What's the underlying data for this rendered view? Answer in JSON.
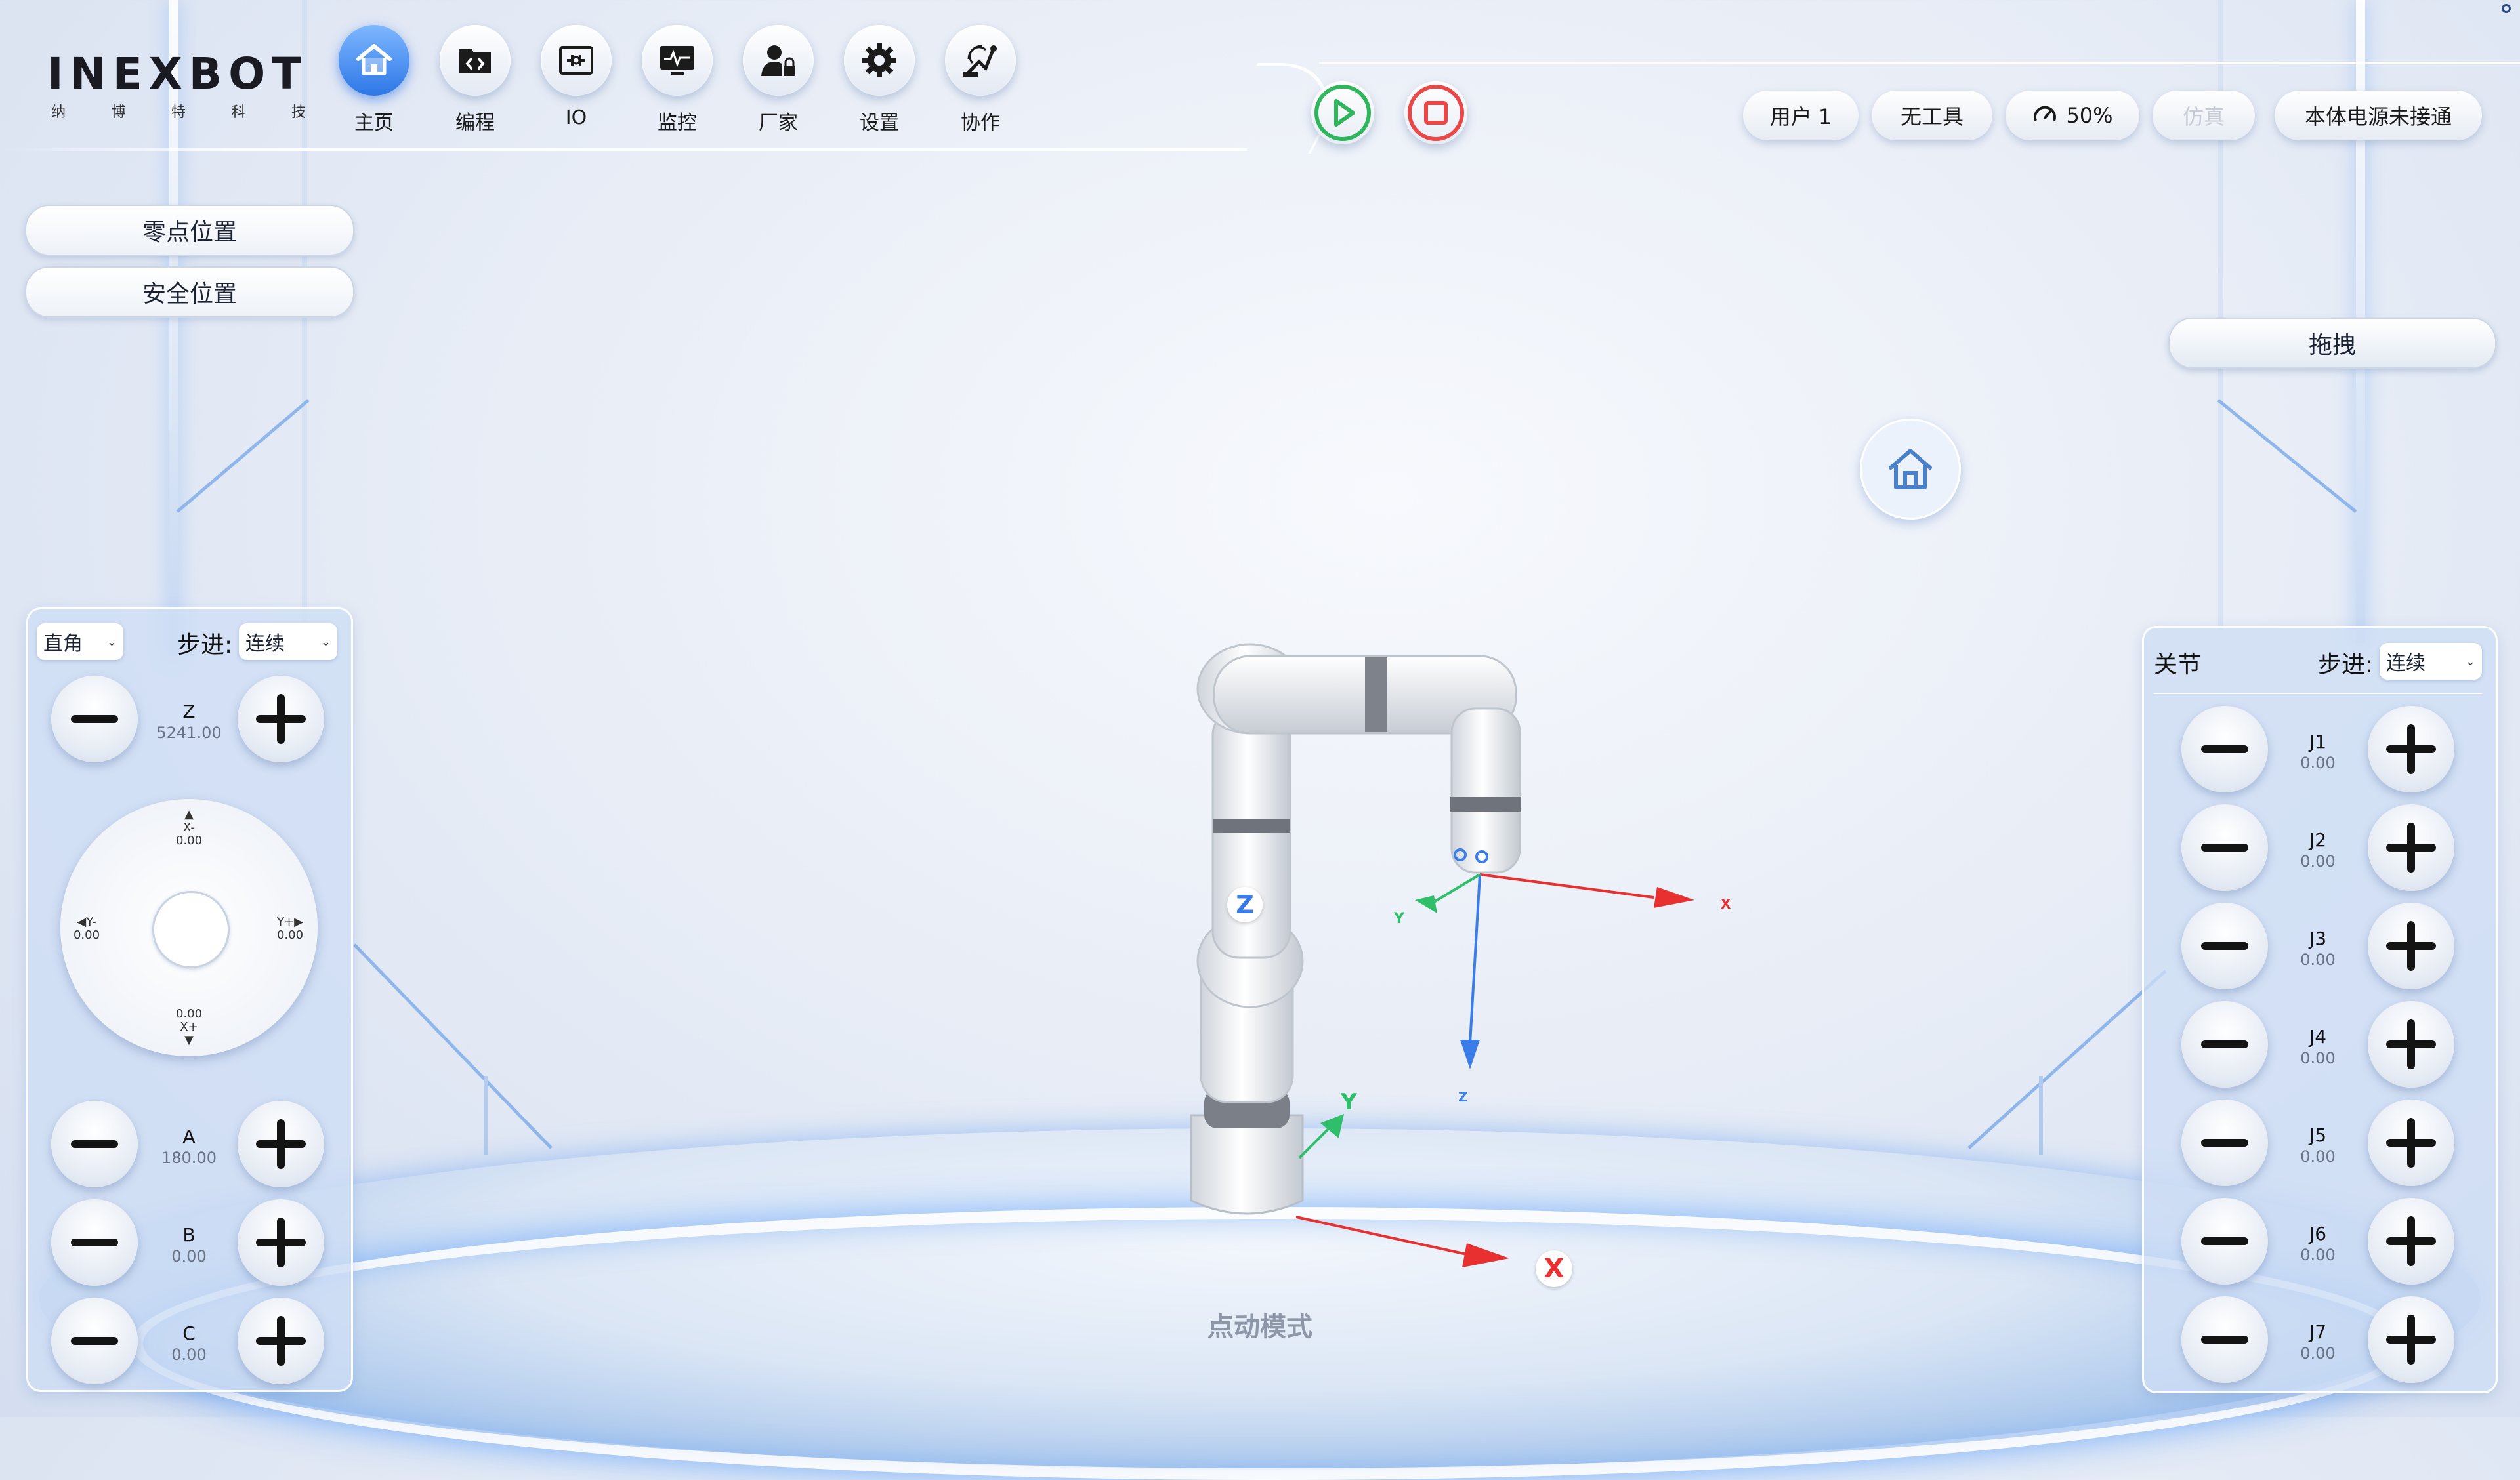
{
  "brand": {
    "name": "INEXBOT",
    "subtitle": [
      "纳",
      "博",
      "特",
      "科",
      "技"
    ]
  },
  "nav": [
    {
      "label": "主页",
      "icon": "home-icon",
      "active": true
    },
    {
      "label": "编程",
      "icon": "code-folder-icon"
    },
    {
      "label": "IO",
      "icon": "io-icon"
    },
    {
      "label": "监控",
      "icon": "monitor-icon"
    },
    {
      "label": "厂家",
      "icon": "manufacturer-lock-icon"
    },
    {
      "label": "设置",
      "icon": "settings-gear-icon"
    },
    {
      "label": "协作",
      "icon": "collaborate-icon"
    }
  ],
  "controls": {
    "run_icon": "play-icon",
    "stop_icon": "stop-icon"
  },
  "status": {
    "user": "用户 1",
    "tool": "无工具",
    "speed": "50%",
    "sim": "仿真",
    "power": "本体电源未接通"
  },
  "left_buttons": {
    "zero": "零点位置",
    "safe": "安全位置"
  },
  "drag_button": "拖拽",
  "cartesian": {
    "coord_select": "直角",
    "step_label": "步进:",
    "step_select": "连续",
    "z": {
      "name": "Z",
      "value": "5241.00"
    },
    "joystick": {
      "x_minus": {
        "name": "X-",
        "value": "0.00"
      },
      "x_plus": {
        "name": "X+",
        "value": "0.00"
      },
      "y_minus": {
        "name": "Y-",
        "value": "0.00"
      },
      "y_plus": {
        "name": "Y+",
        "value": "0.00"
      }
    },
    "a": {
      "name": "A",
      "value": "180.00"
    },
    "b": {
      "name": "B",
      "value": "0.00"
    },
    "c": {
      "name": "C",
      "value": "0.00"
    }
  },
  "joint": {
    "title": "关节",
    "step_label": "步进:",
    "step_select": "连续",
    "joints": [
      {
        "name": "J1",
        "value": "0.00"
      },
      {
        "name": "J2",
        "value": "0.00"
      },
      {
        "name": "J3",
        "value": "0.00"
      },
      {
        "name": "J4",
        "value": "0.00"
      },
      {
        "name": "J5",
        "value": "0.00"
      },
      {
        "name": "J6",
        "value": "0.00"
      },
      {
        "name": "J7",
        "value": "0.00"
      }
    ]
  },
  "scene": {
    "mode": "点动模式",
    "axis_x": "X",
    "axis_y": "Y",
    "axis_z": "Z",
    "tool_x": "X",
    "tool_y": "Y",
    "tool_z": "Z",
    "colors": {
      "x": "#e83030",
      "y": "#2fbf6a",
      "z": "#3a7de8",
      "accent": "#2d77e6"
    }
  }
}
